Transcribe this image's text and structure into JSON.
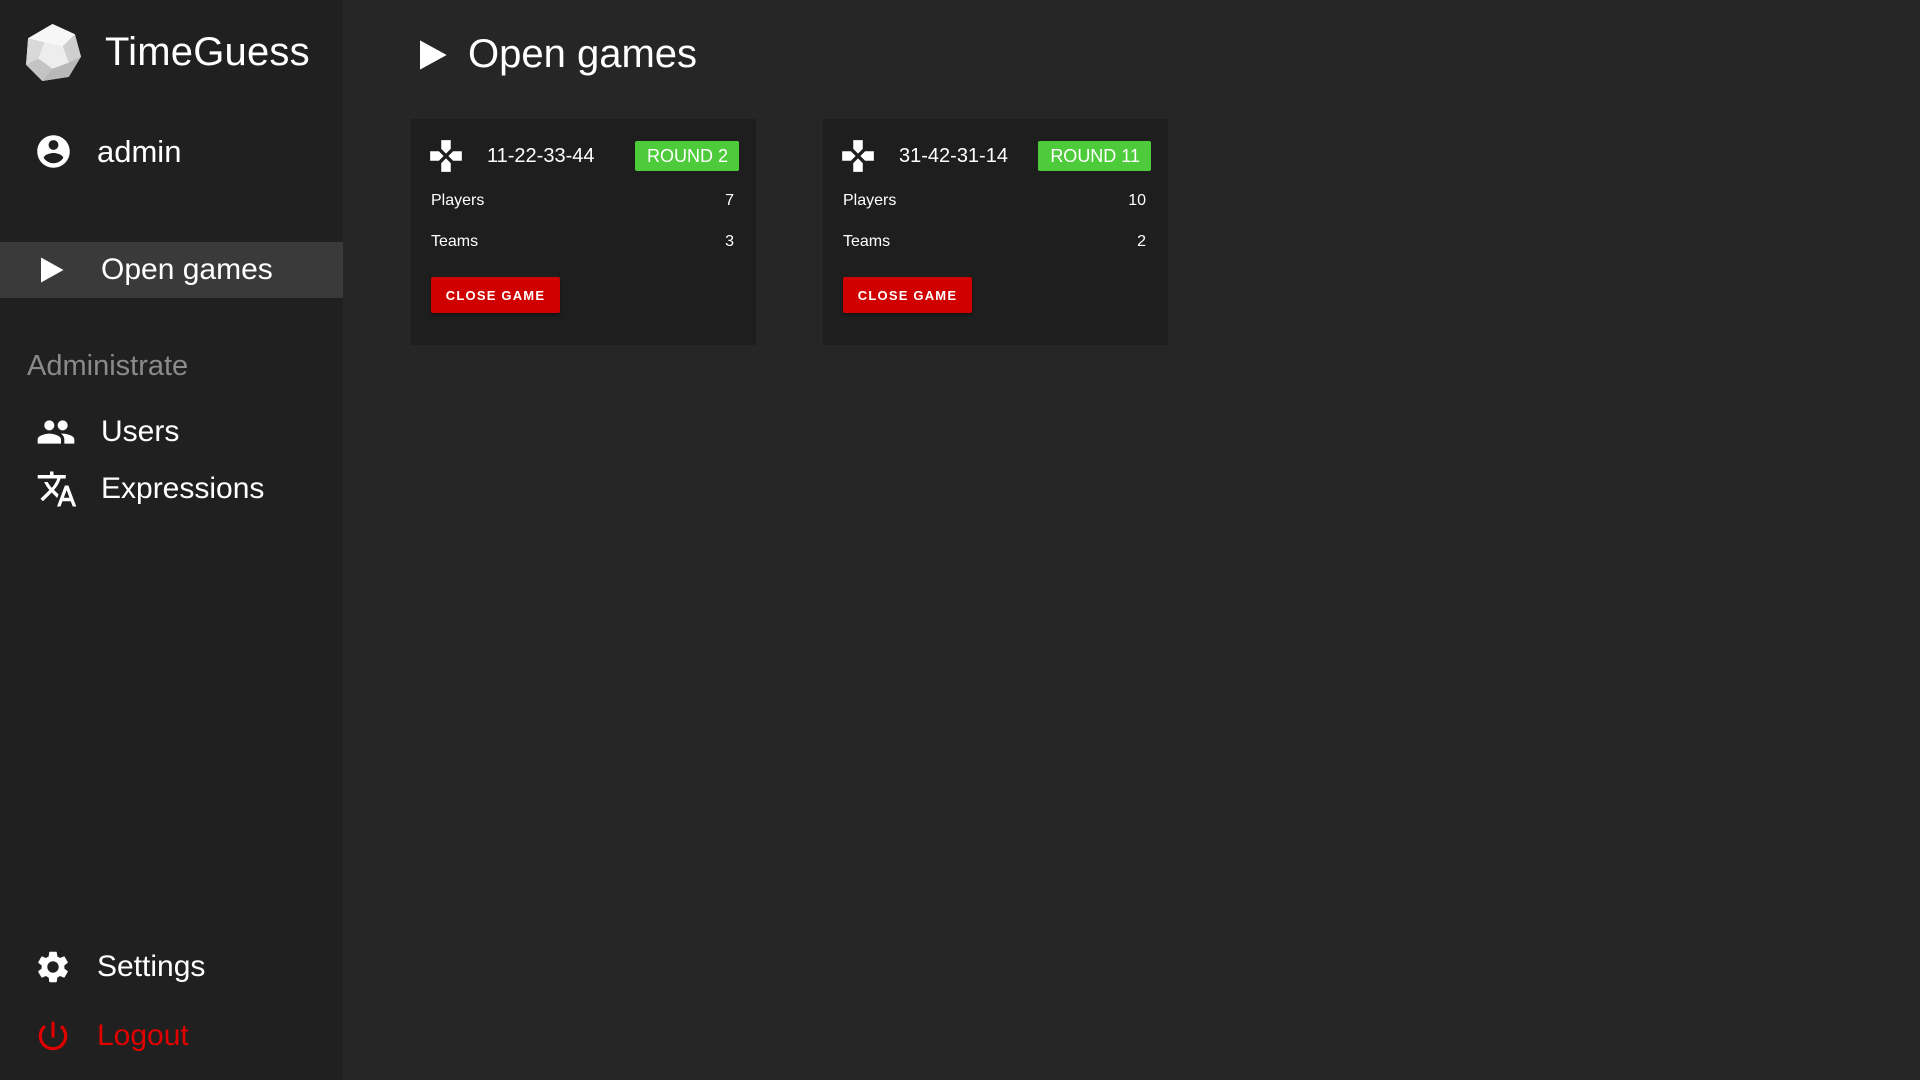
{
  "app": {
    "title": "TimeGuess",
    "logo_icon": "polyhedron-logo-icon"
  },
  "user": {
    "name": "admin",
    "icon": "account-circle-icon"
  },
  "sidebar": {
    "nav": [
      {
        "label": "Open games",
        "icon": "play-icon",
        "active": true
      }
    ],
    "section_header": "Administrate",
    "admin_items": [
      {
        "label": "Users",
        "icon": "people-icon"
      },
      {
        "label": "Expressions",
        "icon": "translate-icon"
      }
    ],
    "bottom_items": [
      {
        "label": "Settings",
        "icon": "gear-icon"
      },
      {
        "label": "Logout",
        "icon": "power-icon",
        "color": "#e00000"
      }
    ]
  },
  "main": {
    "title": "Open games",
    "title_icon": "play-icon",
    "games": [
      {
        "code": "11-22-33-44",
        "round_badge": "ROUND 2",
        "stats": [
          {
            "label": "Players",
            "value": "7"
          },
          {
            "label": "Teams",
            "value": "3"
          }
        ],
        "close_label": "CLOSE GAME"
      },
      {
        "code": "31-42-31-14",
        "round_badge": "ROUND 11",
        "stats": [
          {
            "label": "Players",
            "value": "10"
          },
          {
            "label": "Teams",
            "value": "2"
          }
        ],
        "close_label": "CLOSE GAME"
      }
    ]
  },
  "colors": {
    "background": "#262626",
    "sidebar": "#202020",
    "card": "#1e1e1e",
    "active_nav": "#3a3a3a",
    "badge_green": "#4ecb3a",
    "danger_red": "#d00000",
    "section_header": "#8a8a8a"
  }
}
